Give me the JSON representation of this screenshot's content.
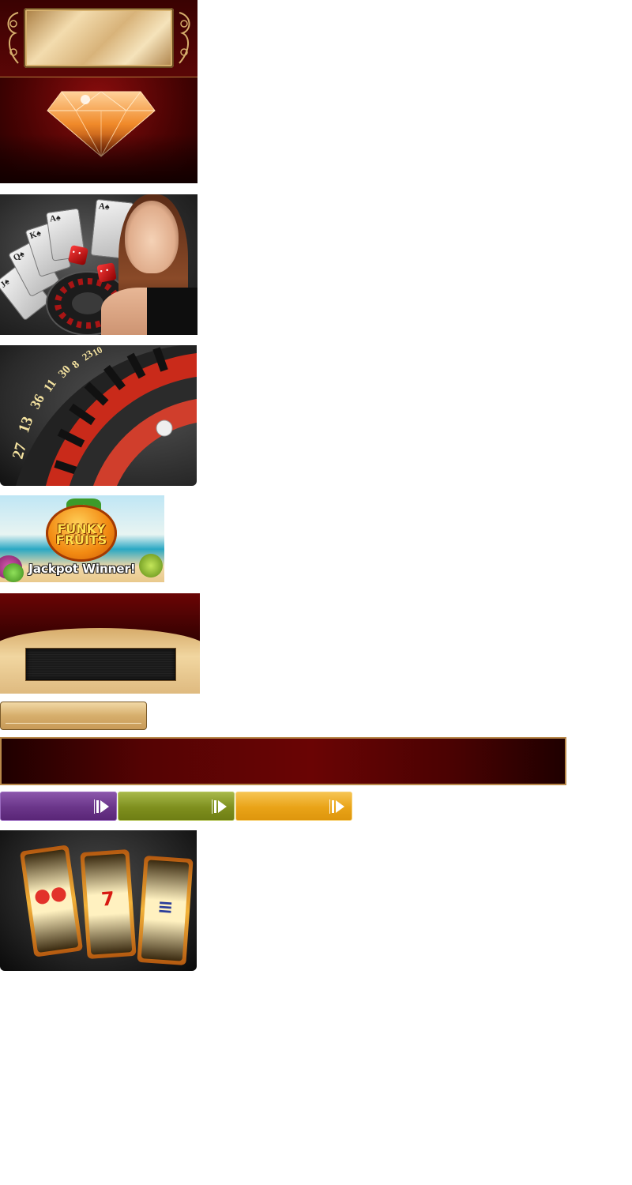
{
  "banners": {
    "fruits": {
      "logo_line1": "FUNKY",
      "logo_line2": "FRUITS",
      "caption": "Jackpot Winner!"
    },
    "roulette": {
      "numbers": [
        "27",
        "13",
        "36",
        "11",
        "30",
        "8",
        "23",
        "10"
      ]
    },
    "cards": {
      "ranks": [
        "J",
        "Q",
        "K",
        "A",
        "A"
      ]
    }
  },
  "colors": {
    "casino_red": "#5a0404",
    "gold": "#d6ae6c",
    "purple": "#6a3589",
    "green": "#7e8f1e",
    "orange": "#e9a317"
  },
  "icons": {
    "play_button_icon": "play-arrow-icon"
  }
}
